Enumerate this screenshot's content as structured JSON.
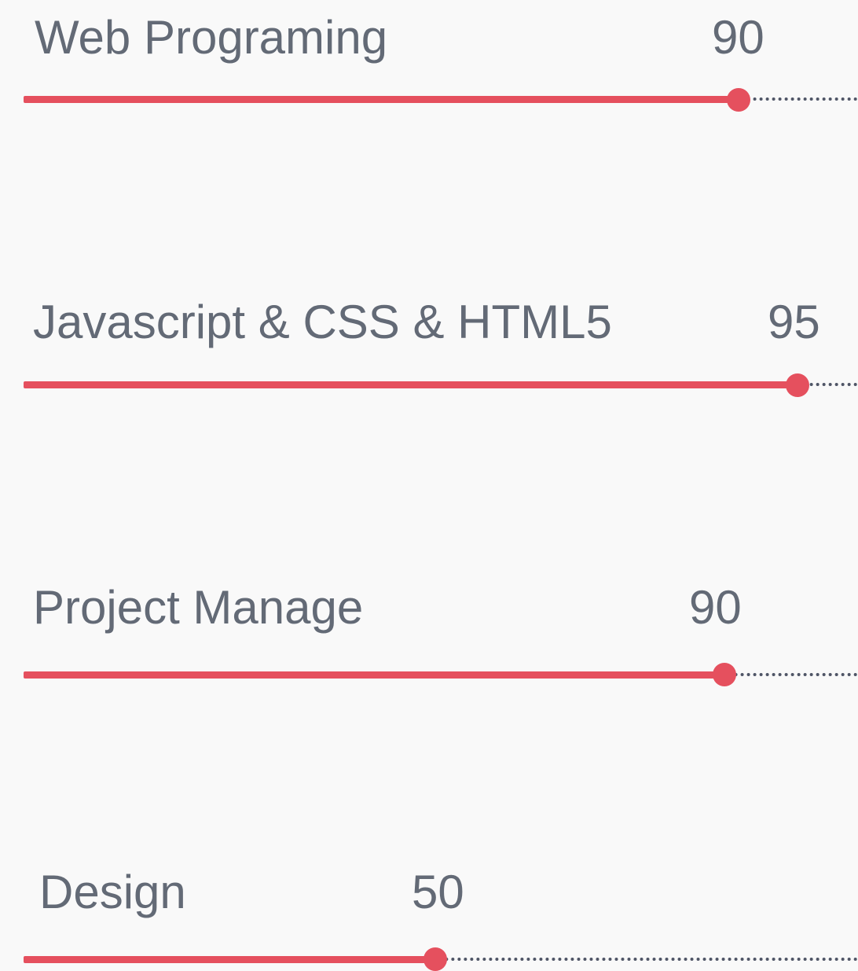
{
  "skills": [
    {
      "name": "Web Programing",
      "value": "90",
      "level": 90
    },
    {
      "name": "Javascript & CSS & HTML5",
      "value": "95",
      "level": 95
    },
    {
      "name": "Project Manage",
      "value": "90",
      "level": 90
    },
    {
      "name": "Design",
      "value": "50",
      "level": 50
    }
  ],
  "colors": {
    "accent": "#e5505e",
    "text": "#636a76",
    "track": "#4f5566",
    "background": "#f9f9f9"
  }
}
